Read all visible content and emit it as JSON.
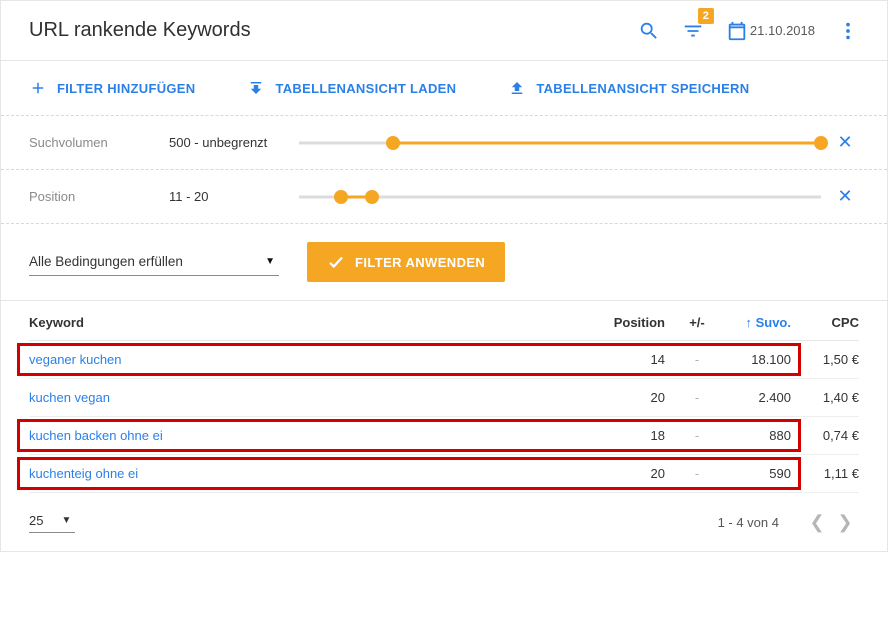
{
  "header": {
    "title": "URL rankende Keywords",
    "filter_badge": "2",
    "date": "21.10.2018"
  },
  "toolbar": {
    "add_filter": "FILTER HINZUFÜGEN",
    "load_view": "TABELLENANSICHT LADEN",
    "save_view": "TABELLENANSICHT SPEICHERN"
  },
  "filters": {
    "suchvolumen": {
      "label": "Suchvolumen",
      "value": "500 - unbegrenzt",
      "range_start_pct": 18,
      "range_end_pct": 100
    },
    "position": {
      "label": "Position",
      "value": "11 - 20",
      "range_start_pct": 8,
      "range_end_pct": 14
    }
  },
  "conditions": {
    "mode_label": "Alle Bedingungen erfüllen",
    "apply_label": "FILTER ANWENDEN"
  },
  "table": {
    "columns": {
      "keyword": "Keyword",
      "position": "Position",
      "delta": "+/-",
      "suvo": "Suvo.",
      "cpc": "CPC"
    },
    "rows": [
      {
        "keyword": "veganer kuchen",
        "position": "14",
        "delta": "-",
        "suvo": "18.100",
        "cpc": "1,50 €",
        "highlight": true
      },
      {
        "keyword": "kuchen vegan",
        "position": "20",
        "delta": "-",
        "suvo": "2.400",
        "cpc": "1,40 €",
        "highlight": false
      },
      {
        "keyword": "kuchen backen ohne ei",
        "position": "18",
        "delta": "-",
        "suvo": "880",
        "cpc": "0,74 €",
        "highlight": true
      },
      {
        "keyword": "kuchenteig ohne ei",
        "position": "20",
        "delta": "-",
        "suvo": "590",
        "cpc": "1,11 €",
        "highlight": true
      }
    ]
  },
  "footer": {
    "page_size": "25",
    "range_text": "1 - 4 von 4"
  }
}
